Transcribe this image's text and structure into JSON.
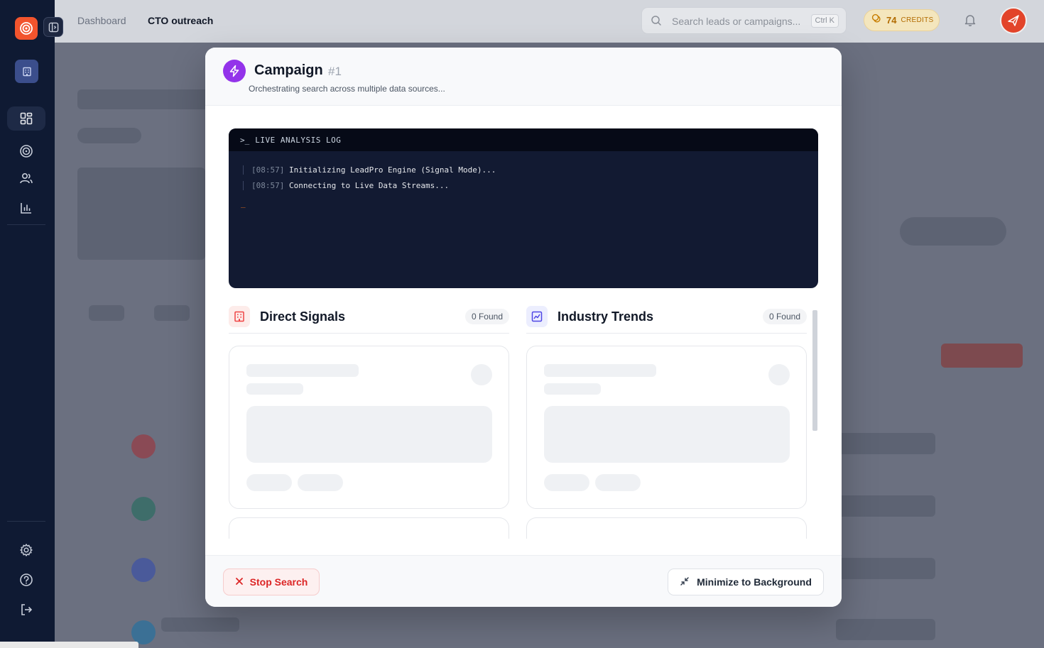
{
  "header": {
    "breadcrumb": [
      "Dashboard",
      "CTO outreach"
    ],
    "search_placeholder": "Search leads or campaigns...",
    "search_shortcut": "Ctrl K",
    "credits_value": "74",
    "credits_label": "CREDITS"
  },
  "sidebar": {
    "icons": [
      "target-logo-icon",
      "sidebar-toggle-icon",
      "building-icon",
      "grid-icon",
      "target-icon",
      "users-icon",
      "bar-chart-icon",
      "gear-icon",
      "help-icon",
      "logout-icon"
    ],
    "active_item": "grid-icon"
  },
  "modal": {
    "title": "Campaign",
    "number": "#1",
    "subtitle": "Orchestrating search across multiple data sources...",
    "log": {
      "prompt": ">_",
      "title": "LIVE ANALYSIS LOG",
      "cursor": "_",
      "lines": [
        {
          "time": "[08:57]",
          "text": "Initializing LeadPro Engine (Signal Mode)..."
        },
        {
          "time": "[08:57]",
          "text": "Connecting to Live Data Streams..."
        }
      ]
    },
    "columns": [
      {
        "title": "Direct Signals",
        "badge": "0 Found",
        "icon": "building-icon",
        "accent": "#ef4444"
      },
      {
        "title": "Industry Trends",
        "badge": "0 Found",
        "icon": "chart-icon",
        "accent": "#4f46e5"
      }
    ],
    "footer": {
      "stop_label": "Stop Search",
      "minimize_label": "Minimize to Background"
    }
  },
  "colors": {
    "brand": "#f2542d",
    "sidebar_bg": "#0f1a33",
    "log_bg": "#121a32",
    "stop": "#dc2626",
    "credits": "#b26b00",
    "campaign_icon": "#9333ea"
  }
}
